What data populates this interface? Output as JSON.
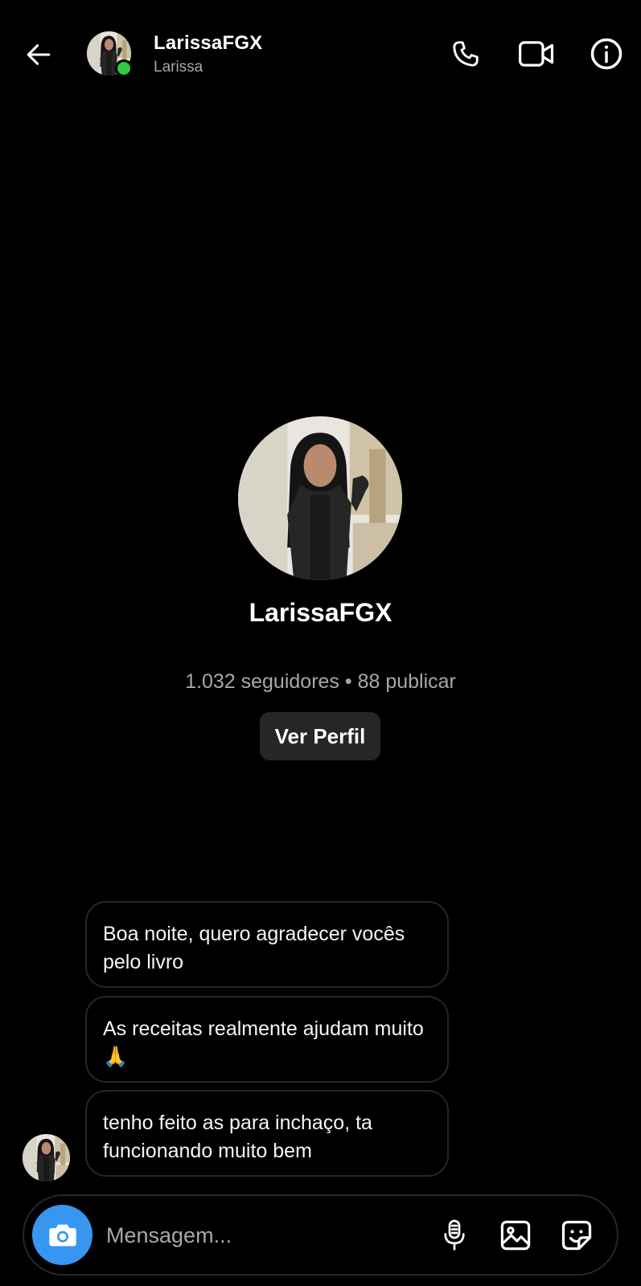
{
  "header": {
    "username": "LarissaFGX",
    "display_name": "Larissa",
    "online": true,
    "icons": [
      "back-arrow-icon",
      "phone-icon",
      "video-camera-icon",
      "info-icon"
    ]
  },
  "profile": {
    "username": "LarissaFGX",
    "stats": "1.032 seguidores • 88 publicar",
    "view_profile_label": "Ver Perfil"
  },
  "messages": [
    {
      "text": "Boa noite, quero agradecer vocês pelo livro"
    },
    {
      "text": "As receitas realmente ajudam muito 🙏"
    },
    {
      "text": "tenho feito as para inchaço, ta funcionando muito bem"
    }
  ],
  "composer": {
    "placeholder": "Mensagem...",
    "icons": [
      "camera-icon",
      "microphone-icon",
      "gallery-icon",
      "sticker-icon"
    ]
  },
  "colors": {
    "background": "#000000",
    "bubble_border": "#262626",
    "accent_blue": "#3797f0",
    "online_green": "#2ecc40",
    "secondary_text": "#a8a8a8"
  }
}
